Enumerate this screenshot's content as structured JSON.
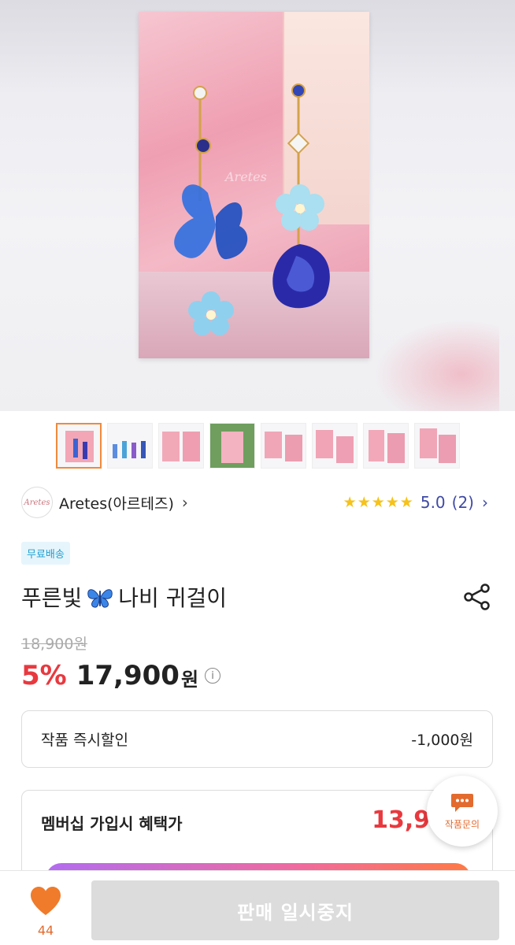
{
  "gallery": {
    "thumbnail_count": 8,
    "active_index": 0,
    "watermark": "Aretes"
  },
  "seller": {
    "name": "Aretes(아르테즈)",
    "avatar_text": "Aretes"
  },
  "rating": {
    "stars": "★★★★★",
    "score": "5.0",
    "count": "(2)"
  },
  "badge": "무료배송",
  "product": {
    "title_before": "푸른빛",
    "title_after": "나비 귀걸이",
    "emoji": "butterfly-icon"
  },
  "price": {
    "original": "18,900원",
    "discount": "5%",
    "amount": "17,900",
    "unit": "원",
    "info_icon": "i"
  },
  "discount_row": {
    "label": "작품 즉시할인",
    "value": "-1,000원"
  },
  "membership_row": {
    "label": "멤버십 가입시 혜택가",
    "value": "13,90"
  },
  "inquiry_button": {
    "label": "작품문의"
  },
  "bottom": {
    "like_count": "44",
    "action_label": "판매 일시중지"
  },
  "colors": {
    "accent_orange": "#e36b2e",
    "price_red": "#e8393f",
    "rating_blue": "#3f4aa6",
    "star_yellow": "#f6c21b",
    "badge_blue": "#1f9fd2"
  }
}
